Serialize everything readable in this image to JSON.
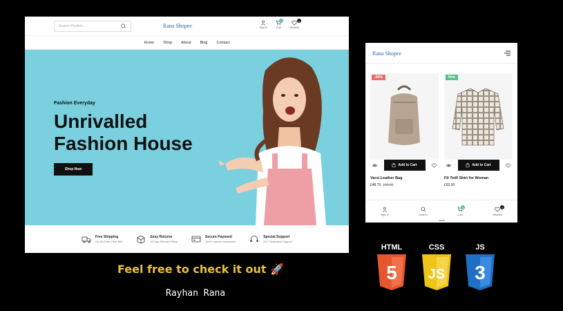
{
  "desktop": {
    "search": {
      "placeholder": "Search Product..."
    },
    "brand": "Rana Shopee",
    "header_icons": [
      {
        "label": "Sign in",
        "icon": "user-icon",
        "badge": ""
      },
      {
        "label": "Cart",
        "icon": "cart-icon",
        "badge": "0"
      },
      {
        "label": "Wishlist",
        "icon": "heart-icon",
        "badge": "0"
      }
    ],
    "nav": [
      "Home",
      "Shop",
      "About",
      "Blog",
      "Contact"
    ],
    "hero": {
      "kicker": "Fashion Everyday",
      "title": "Unrivalled Fashion House",
      "button": "Shop Now",
      "bg_color": "#7ad0df"
    },
    "features": [
      {
        "icon": "truck-icon",
        "title": "Free Shipping",
        "subtitle": "On All Order Over $99"
      },
      {
        "icon": "box-return-icon",
        "title": "Easy Returns",
        "subtitle": "30 Day Returns Policy"
      },
      {
        "icon": "credit-card-icon",
        "title": "Secure Payment",
        "subtitle": "100% Secure Gaurantee"
      },
      {
        "icon": "headset-icon",
        "title": "Special Support",
        "subtitle": "24/7 Dedicated Support"
      }
    ]
  },
  "mobile": {
    "brand": "Rana Shopee",
    "products": [
      {
        "tag": "-35%",
        "tag_color": "#e86b6b",
        "image": "backpack",
        "add_label": "Add to Cart",
        "name": "Varsi Leather Bag",
        "price": "£48.75",
        "old_price": "£65.00"
      },
      {
        "tag": "New",
        "tag_color": "#57c08a",
        "image": "plaid-shirt",
        "add_label": "Add to Cart",
        "name": "Fit Twill Shirt for Woman",
        "price": "£62.00",
        "old_price": ""
      }
    ],
    "tabs": [
      {
        "label": "Sign in",
        "icon": "user-icon",
        "badge": ""
      },
      {
        "label": "Search",
        "icon": "search-icon",
        "badge": ""
      },
      {
        "label": "Cart",
        "icon": "cart-icon",
        "badge": "0"
      },
      {
        "label": "Wishlist",
        "icon": "heart-icon",
        "badge": "0"
      }
    ]
  },
  "caption": "Feel free to check it out 🚀",
  "author": "Rayhan Rana",
  "tech_badges": [
    {
      "label": "HTML",
      "digit": "5",
      "color": "#e4572e"
    },
    {
      "label": "CSS",
      "digit": "JS",
      "color": "#f0c419"
    },
    {
      "label": "JS",
      "digit": "3",
      "color": "#1f6fc5"
    }
  ]
}
